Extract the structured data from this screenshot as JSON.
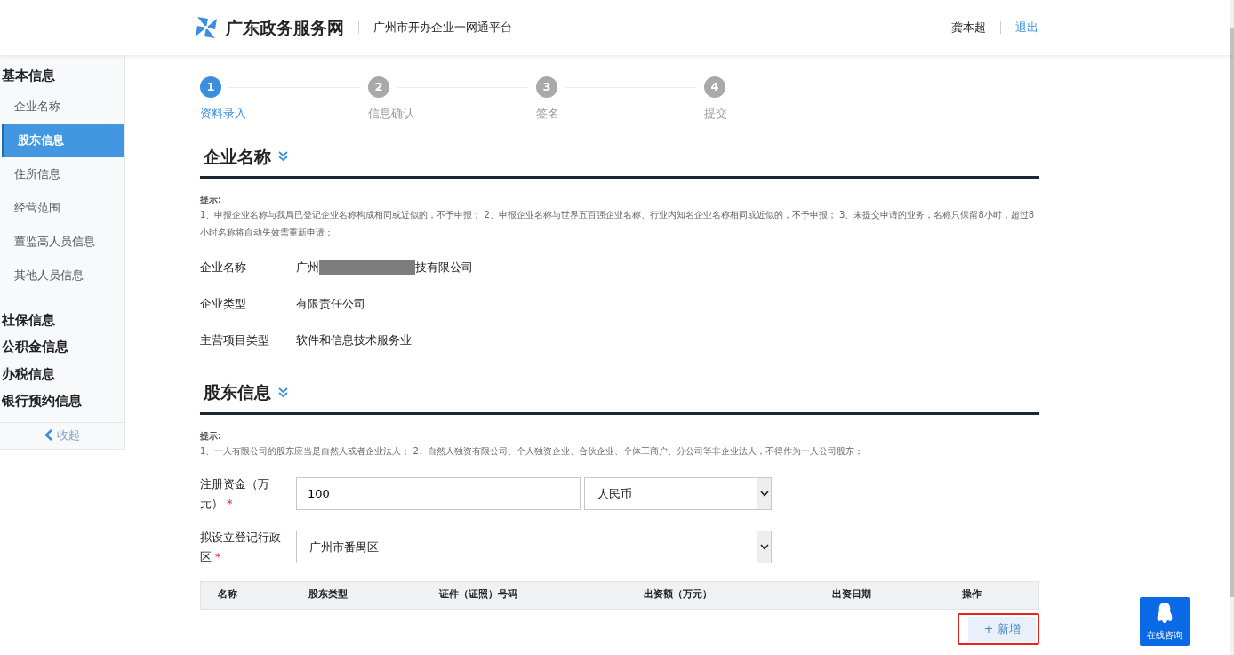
{
  "header": {
    "site_title": "广东政务服务网",
    "platform": "广州市开办企业一网通平台",
    "user": "龚本超",
    "logout": "退出"
  },
  "sidebar": {
    "groups": [
      {
        "title": "基本信息",
        "items": [
          {
            "label": "企业名称",
            "selected": false
          },
          {
            "label": "股东信息",
            "selected": true
          },
          {
            "label": "住所信息",
            "selected": false
          },
          {
            "label": "经营范围",
            "selected": false
          },
          {
            "label": "董监高人员信息",
            "selected": false
          },
          {
            "label": "其他人员信息",
            "selected": false
          }
        ]
      },
      {
        "title": "社保信息"
      },
      {
        "title": "公积金信息"
      },
      {
        "title": "办税信息"
      },
      {
        "title": "银行预约信息"
      }
    ],
    "collapse": "收起"
  },
  "steps": [
    {
      "number": "1",
      "label": "资料录入",
      "active": true
    },
    {
      "number": "2",
      "label": "信息确认",
      "active": false
    },
    {
      "number": "3",
      "label": "签名",
      "active": false
    },
    {
      "number": "4",
      "label": "提交",
      "active": false
    }
  ],
  "sections": [
    {
      "title": "企业名称",
      "tip_title": "提示:",
      "tip_text": "1、申报企业名称与我局已登记企业名称构成相同或近似的，不予申报； 2、申报企业名称与世界五百强企业名称、行业内知名企业名称相同或近似的，不予申报； 3、未提交申请的业务，名称只保留8小时，超过8小时名称将自动失效需重新申请；",
      "fields": [
        {
          "label": "企业名称",
          "value_before": "广州",
          "redacted": true,
          "value_after": "技有限公司"
        },
        {
          "label": "企业类型",
          "value_before": "有限责任公司",
          "redacted": false
        },
        {
          "label": "主营项目类型",
          "value_before": "软件和信息技术服务业",
          "redacted": false
        }
      ]
    },
    {
      "title": "股东信息",
      "tip_title": "提示:",
      "tip_text": "1、一人有限公司的股东应当是自然人或者企业法人； 2、自然人独资有限公司、个人独资企业、合伙企业、个体工商户、分公司等非企业法人，不得作为一人公司股东；",
      "form_rows": [
        {
          "label": "注册资金（万元）",
          "required_mark": "*",
          "controls": [
            {
              "kind": "input",
              "value": "100"
            },
            {
              "kind": "select",
              "value": "人民币"
            }
          ]
        },
        {
          "label": "拟设立登记行政区",
          "required_mark": "*",
          "controls": [
            {
              "kind": "select",
              "value": "广州市番禺区"
            }
          ]
        }
      ],
      "table": {
        "columns": [
          "名称",
          "股东类型",
          "证件（证照）号码",
          "出资额（万元）",
          "出资日期",
          "操作"
        ]
      },
      "add_button": "+ 新增",
      "add_button_highlighted": true
    }
  ],
  "consult_button": "在线咨询"
}
